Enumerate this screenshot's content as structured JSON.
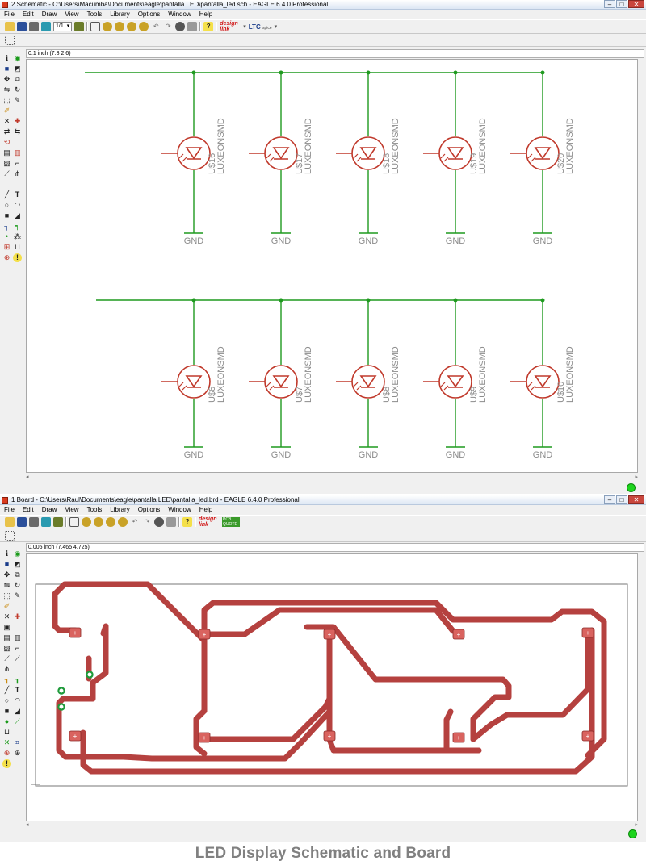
{
  "schematic_window": {
    "title": "2 Schematic - C:\\Users\\Macumba\\Documents\\eagle\\pantalla LED\\pantalla_led.sch - EAGLE 6.4.0 Professional",
    "menus": [
      "File",
      "Edit",
      "Draw",
      "View",
      "Tools",
      "Library",
      "Options",
      "Window",
      "Help"
    ],
    "sheet_selector": "1/1",
    "coordinate_readout": "0.1 inch (7.8 2.6)",
    "designlink_logo": "design link",
    "ltc_logo": "LTC",
    "ltc_sub": "spice",
    "top_row": [
      {
        "ref": "U$16",
        "value": "LUXEONSMD",
        "gnd": "GND"
      },
      {
        "ref": "U$17",
        "value": "LUXEONSMD",
        "gnd": "GND"
      },
      {
        "ref": "U$18",
        "value": "LUXEONSMD",
        "gnd": "GND"
      },
      {
        "ref": "U$19",
        "value": "LUXEONSMD",
        "gnd": "GND"
      },
      {
        "ref": "U$20",
        "value": "LUXEONSMD",
        "gnd": "GND"
      }
    ],
    "bottom_row": [
      {
        "ref": "U$6",
        "value": "LUXEONSMD",
        "gnd": "GND"
      },
      {
        "ref": "U$7",
        "value": "LUXEONSMD",
        "gnd": "GND"
      },
      {
        "ref": "U$8",
        "value": "LUXEONSMD",
        "gnd": "GND"
      },
      {
        "ref": "U$9",
        "value": "LUXEONSMD",
        "gnd": "GND"
      },
      {
        "ref": "U$10",
        "value": "LUXEONSMD",
        "gnd": "GND"
      }
    ]
  },
  "board_window": {
    "title": "1 Board - C:\\Users\\Raul\\Documents\\eagle\\pantalla LED\\pantalla_led.brd - EAGLE 6.4.0 Professional",
    "menus": [
      "File",
      "Edit",
      "Draw",
      "View",
      "Tools",
      "Library",
      "Options",
      "Window",
      "Help"
    ],
    "coordinate_readout": "0.005 inch (7.465 4.725)",
    "designlink_logo": "design link",
    "pcb_logo": "PCB QUOTE",
    "pad_symbol": "+"
  },
  "caption": "LED Display Schematic and Board",
  "colors": {
    "wire": "#1f9a1f",
    "symbol": "#c0392b",
    "label": "#8c8c8c",
    "trace": "#b5413f",
    "pad": "#d9635f",
    "via": "#1e9a3a",
    "status_ok": "#1ed41e"
  },
  "icons": {
    "schematic_tools": [
      "info-icon",
      "eye-icon",
      "layers-icon",
      "display-icon",
      "move-icon",
      "copy-icon",
      "mirror-icon",
      "rotate-icon",
      "group-icon",
      "change-icon",
      "cut-icon",
      "paste-icon",
      "delete-icon",
      "add-icon",
      "pinswap-icon",
      "replace-icon",
      "gateswap-icon",
      "name-icon",
      "value-icon",
      "smash-icon",
      "miter-icon",
      "split-icon",
      "invoke-icon",
      "label-icon",
      "wire-icon",
      "text-icon",
      "circle-icon",
      "arc-icon",
      "rect-icon",
      "polygon-icon",
      "bus-icon",
      "net-icon",
      "junction-icon",
      "attribute-icon",
      "erc-icon",
      "errors-icon"
    ],
    "toolbar": [
      "open-icon",
      "save-icon",
      "print-icon",
      "cam-icon",
      "board-icon",
      "undo-icon",
      "redo-icon",
      "zoom-fit-icon",
      "zoom-in-icon",
      "zoom-out-icon",
      "zoom-redraw-icon",
      "zoom-select-icon",
      "stop-icon",
      "go-icon",
      "help-icon"
    ]
  }
}
